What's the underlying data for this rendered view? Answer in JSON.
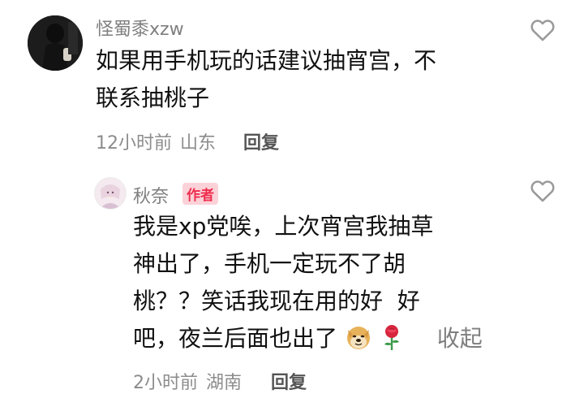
{
  "comment": {
    "username": "怪蜀黍xzw",
    "lines": [
      "如果用手机玩的话建议抽宵宫，不",
      "联系抽桃子"
    ],
    "time": "12小时前",
    "location": "山东",
    "reply_label": "回复",
    "heart_icon": "heart-outline-icon"
  },
  "reply": {
    "username": "秋奈",
    "badge": "作者",
    "lines": [
      "我是xp党唉，上次宵宫我抽草",
      "神出了，手机一定玩不了胡",
      "桃？？笑话我现在用的好  好",
      "吧，夜兰后面也出了"
    ],
    "emojis": [
      "doge-emoji",
      "rose-emoji"
    ],
    "collapse_label": "收起",
    "time": "2小时前",
    "location": "湖南",
    "reply_label": "回复",
    "heart_icon": "heart-outline-icon"
  }
}
